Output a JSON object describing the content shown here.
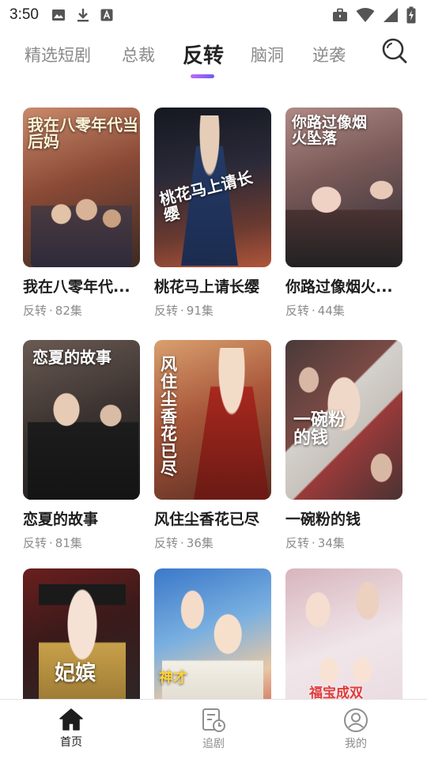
{
  "status_bar": {
    "time": "3:50",
    "left_icons": [
      "image-icon",
      "download-icon",
      "font-icon"
    ],
    "right_icons": [
      "briefcase-icon",
      "wifi-icon",
      "signal-icon",
      "battery-charging-icon"
    ]
  },
  "tabs": [
    {
      "label": "精选短剧",
      "active": false
    },
    {
      "label": "总裁",
      "active": false
    },
    {
      "label": "反转",
      "active": true
    },
    {
      "label": "脑洞",
      "active": false
    },
    {
      "label": "逆袭",
      "active": false
    }
  ],
  "search_icon": "search-icon",
  "accent_gradient": [
    "#c06cf0",
    "#6b5cf5"
  ],
  "dramas": [
    {
      "title": "我在八零年代...",
      "category": "反转",
      "separator": "·",
      "episodes": "82集",
      "poster_text": "我在八零年代当后妈",
      "poster_colors": [
        "#7a3b2c",
        "#c9876a",
        "#3b2a24"
      ]
    },
    {
      "title": "桃花马上请长缨",
      "category": "反转",
      "separator": "·",
      "episodes": "91集",
      "poster_text": "桃花马上请长缨",
      "poster_colors": [
        "#1f2433",
        "#5a3a3a",
        "#b0553a"
      ]
    },
    {
      "title": "你路过像烟火...",
      "category": "反转",
      "separator": "·",
      "episodes": "44集",
      "poster_text": "你路过像烟火坠落",
      "poster_colors": [
        "#6c4a44",
        "#b08a86",
        "#2a2a35"
      ]
    },
    {
      "title": "恋夏的故事",
      "category": "反转",
      "separator": "·",
      "episodes": "81集",
      "poster_text": "恋夏的故事",
      "poster_colors": [
        "#3a3230",
        "#8a7a72",
        "#1a1a1a"
      ]
    },
    {
      "title": "风住尘香花已尽",
      "category": "反转",
      "separator": "·",
      "episodes": "36集",
      "poster_text": "风住尘香花已尽",
      "poster_colors": [
        "#5a2e22",
        "#a8563a",
        "#d9a06e"
      ]
    },
    {
      "title": "一碗粉的钱",
      "category": "反转",
      "separator": "·",
      "episodes": "34集",
      "poster_text": "一碗粉的钱",
      "poster_colors": [
        "#4a3a3a",
        "#9a3a3a",
        "#d4d0cc"
      ]
    },
    {
      "title": "",
      "category": "",
      "separator": "",
      "episodes": "",
      "poster_text": "妃嫔",
      "poster_colors": [
        "#6b1e1e",
        "#c7a04a",
        "#2a2a2a"
      ]
    },
    {
      "title": "",
      "category": "",
      "separator": "",
      "episodes": "",
      "poster_text": "神才",
      "poster_colors": [
        "#3a78c9",
        "#e7c7a4",
        "#c94a3a"
      ]
    },
    {
      "title": "",
      "category": "",
      "separator": "",
      "episodes": "",
      "poster_text": "福宝成双",
      "poster_colors": [
        "#d8b5bd",
        "#f0e6ea",
        "#c94a5a"
      ]
    }
  ],
  "bottom_nav": [
    {
      "label": "首页",
      "icon": "home-icon",
      "active": true
    },
    {
      "label": "追剧",
      "icon": "watchlist-clock-icon",
      "active": false
    },
    {
      "label": "我的",
      "icon": "profile-icon",
      "active": false
    }
  ]
}
